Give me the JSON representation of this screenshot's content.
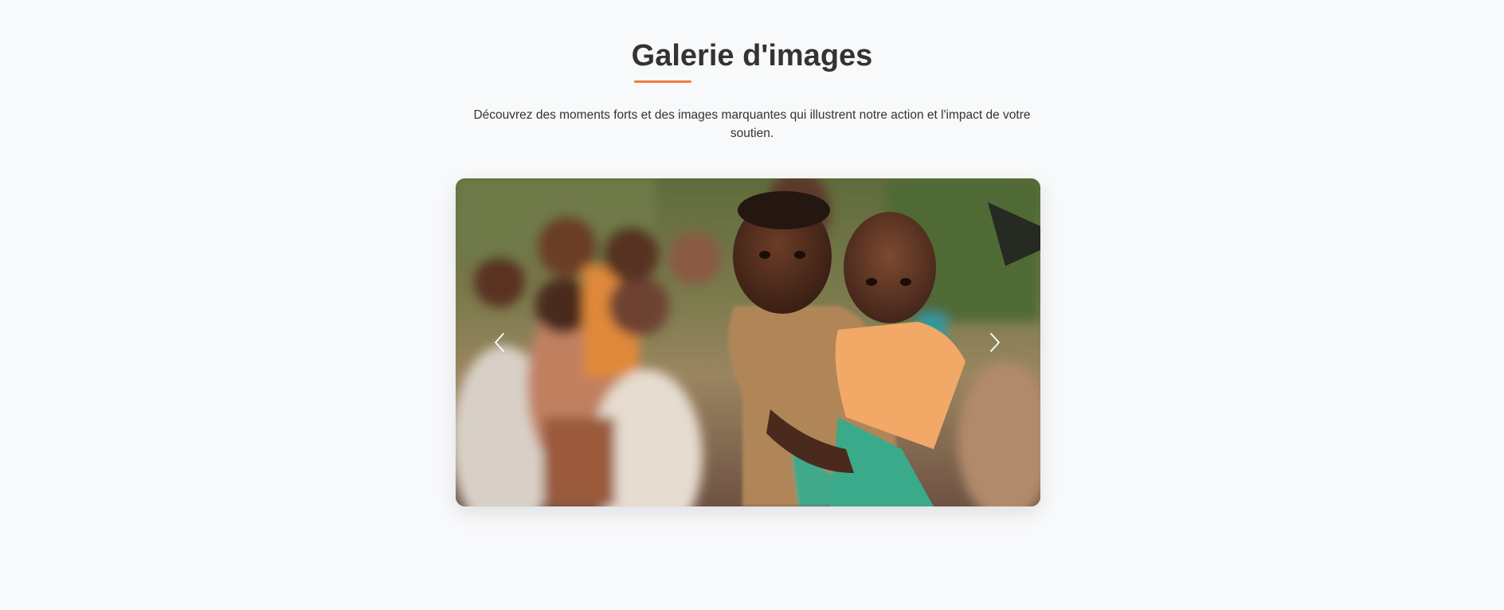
{
  "gallery": {
    "title": "Galerie d'images",
    "description": "Découvrez des moments forts et des images marquantes qui illustrent notre action et l'impact de votre soutien.",
    "accent_color": "#f47b3f",
    "slide": {
      "subject": "children-photo"
    },
    "controls": {
      "prev_icon": "chevron-left-icon",
      "next_icon": "chevron-right-icon"
    }
  }
}
